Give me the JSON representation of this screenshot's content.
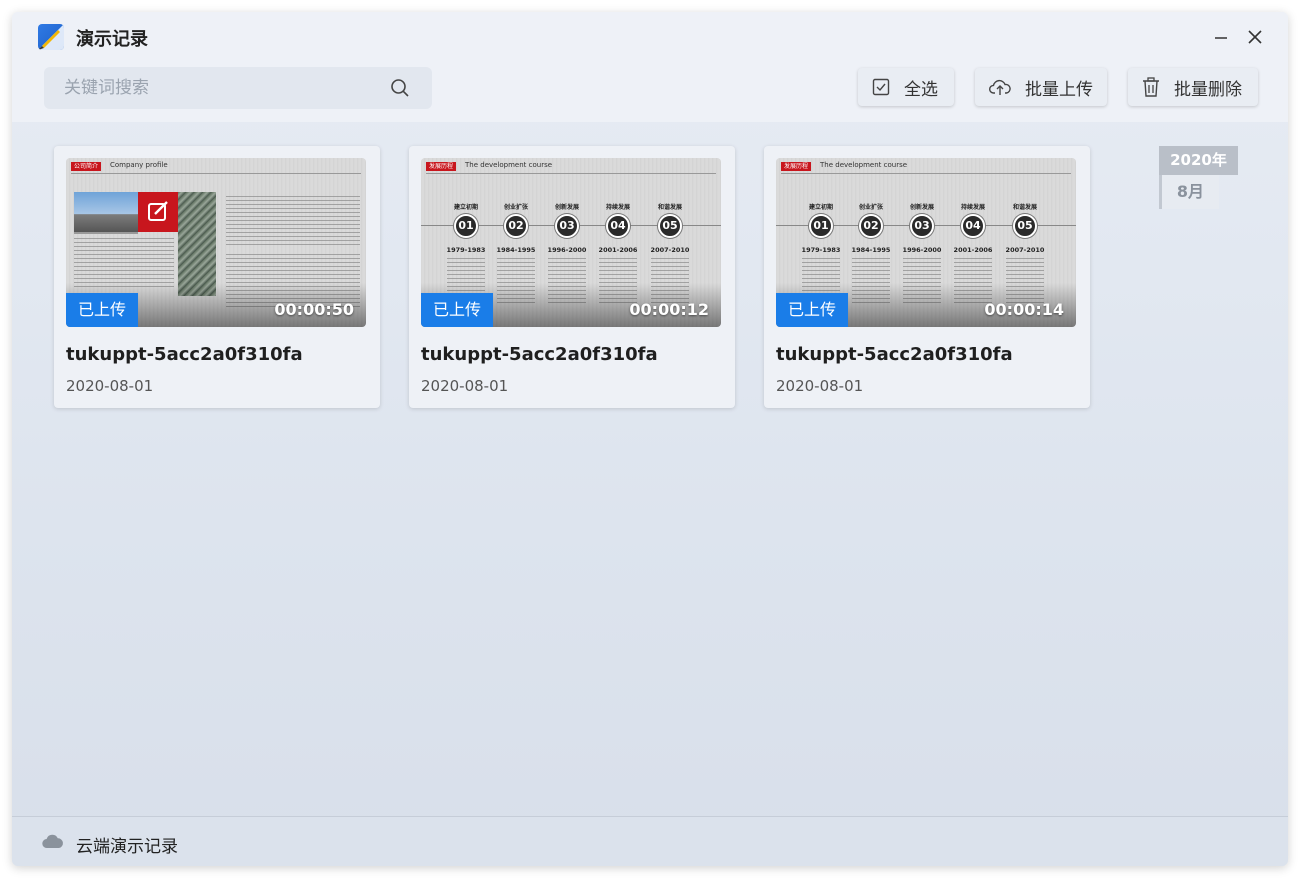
{
  "app": {
    "title": "演示记录",
    "accent_color": "#1a7de8"
  },
  "toolbar": {
    "search_placeholder": "关键词搜索",
    "select_all_label": "全选",
    "batch_upload_label": "批量上传",
    "batch_delete_label": "批量删除"
  },
  "date_marker": {
    "year": "2020年",
    "month": "8月"
  },
  "records": [
    {
      "title": "tukuppt-5acc2a0f310fa",
      "date": "2020-08-01",
      "duration": "00:00:50",
      "status": "已上传",
      "thumb": {
        "tag": "公司简介",
        "subtitle": "Company profile"
      }
    },
    {
      "title": "tukuppt-5acc2a0f310fa",
      "date": "2020-08-01",
      "duration": "00:00:12",
      "status": "已上传",
      "thumb": {
        "tag": "发展历程",
        "subtitle": "The development course",
        "stages": [
          "建立初期",
          "创业扩张",
          "创新发展",
          "持续发展",
          "和谐发展"
        ],
        "numbers": [
          "01",
          "02",
          "03",
          "04",
          "05"
        ],
        "years": [
          "1979-1983",
          "1984-1995",
          "1996-2000",
          "2001-2006",
          "2007-2010"
        ]
      }
    },
    {
      "title": "tukuppt-5acc2a0f310fa",
      "date": "2020-08-01",
      "duration": "00:00:14",
      "status": "已上传",
      "thumb": {
        "tag": "发展历程",
        "subtitle": "The development course",
        "stages": [
          "建立初期",
          "创业扩张",
          "创新发展",
          "持续发展",
          "和谐发展"
        ],
        "numbers": [
          "01",
          "02",
          "03",
          "04",
          "05"
        ],
        "years": [
          "1979-1983",
          "1984-1995",
          "1996-2000",
          "2001-2006",
          "2007-2010"
        ]
      }
    }
  ],
  "footer": {
    "label": "云端演示记录"
  }
}
